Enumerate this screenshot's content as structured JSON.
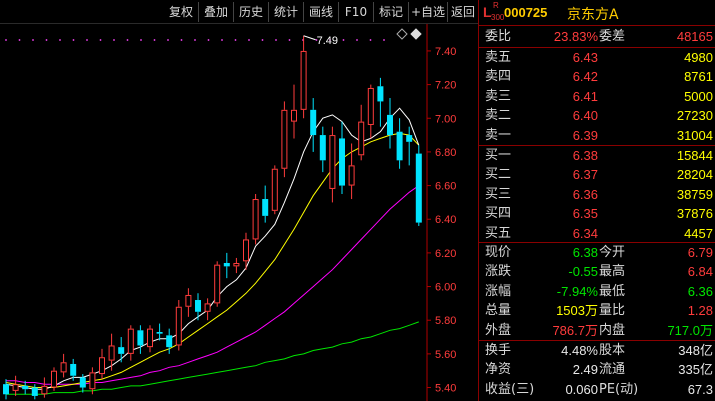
{
  "toolbar": {
    "buttons": [
      "复权",
      "叠加",
      "历史",
      "统计",
      "画线",
      "F10",
      "标记",
      "+自选",
      "返回"
    ]
  },
  "chart": {
    "high_label": "7.49",
    "y_ticks": [
      "7.40",
      "7.20",
      "7.00",
      "6.80",
      "6.60",
      "6.40",
      "6.20",
      "6.00",
      "5.80",
      "5.60",
      "5.40"
    ],
    "ylim": [
      5.32,
      7.56
    ],
    "candles": [
      {
        "o": 5.42,
        "c": 5.36,
        "h": 5.45,
        "l": 5.33
      },
      {
        "o": 5.38,
        "c": 5.42,
        "h": 5.47,
        "l": 5.35
      },
      {
        "o": 5.41,
        "c": 5.39,
        "h": 5.44,
        "l": 5.36
      },
      {
        "o": 5.4,
        "c": 5.35,
        "h": 5.42,
        "l": 5.33
      },
      {
        "o": 5.36,
        "c": 5.41,
        "h": 5.46,
        "l": 5.34
      },
      {
        "o": 5.4,
        "c": 5.5,
        "h": 5.52,
        "l": 5.38
      },
      {
        "o": 5.49,
        "c": 5.55,
        "h": 5.6,
        "l": 5.46
      },
      {
        "o": 5.54,
        "c": 5.47,
        "h": 5.57,
        "l": 5.44
      },
      {
        "o": 5.46,
        "c": 5.4,
        "h": 5.48,
        "l": 5.37
      },
      {
        "o": 5.39,
        "c": 5.49,
        "h": 5.52,
        "l": 5.36
      },
      {
        "o": 5.48,
        "c": 5.58,
        "h": 5.63,
        "l": 5.45
      },
      {
        "o": 5.56,
        "c": 5.65,
        "h": 5.72,
        "l": 5.5
      },
      {
        "o": 5.64,
        "c": 5.6,
        "h": 5.7,
        "l": 5.55
      },
      {
        "o": 5.6,
        "c": 5.75,
        "h": 5.77,
        "l": 5.56
      },
      {
        "o": 5.74,
        "c": 5.65,
        "h": 5.77,
        "l": 5.6
      },
      {
        "o": 5.64,
        "c": 5.75,
        "h": 5.77,
        "l": 5.61
      },
      {
        "o": 5.73,
        "c": 5.72,
        "h": 5.78,
        "l": 5.68
      },
      {
        "o": 5.71,
        "c": 5.64,
        "h": 5.75,
        "l": 5.6
      },
      {
        "o": 5.65,
        "c": 5.88,
        "h": 5.92,
        "l": 5.62
      },
      {
        "o": 5.88,
        "c": 5.95,
        "h": 5.99,
        "l": 5.82
      },
      {
        "o": 5.92,
        "c": 5.85,
        "h": 5.96,
        "l": 5.8
      },
      {
        "o": 5.85,
        "c": 5.9,
        "h": 5.93,
        "l": 5.8
      },
      {
        "o": 5.9,
        "c": 6.13,
        "h": 6.15,
        "l": 5.88
      },
      {
        "o": 6.14,
        "c": 6.12,
        "h": 6.2,
        "l": 6.05
      },
      {
        "o": 6.12,
        "c": 6.14,
        "h": 6.17,
        "l": 6.08
      },
      {
        "o": 6.15,
        "c": 6.28,
        "h": 6.32,
        "l": 6.1
      },
      {
        "o": 6.28,
        "c": 6.52,
        "h": 6.55,
        "l": 6.25
      },
      {
        "o": 6.52,
        "c": 6.42,
        "h": 6.6,
        "l": 6.38
      },
      {
        "o": 6.45,
        "c": 6.7,
        "h": 6.72,
        "l": 6.43
      },
      {
        "o": 6.7,
        "c": 7.05,
        "h": 7.1,
        "l": 6.65
      },
      {
        "o": 6.98,
        "c": 7.05,
        "h": 7.2,
        "l": 6.88
      },
      {
        "o": 7.05,
        "c": 7.4,
        "h": 7.49,
        "l": 7.0
      },
      {
        "o": 7.05,
        "c": 6.9,
        "h": 7.12,
        "l": 6.8
      },
      {
        "o": 6.9,
        "c": 6.75,
        "h": 6.95,
        "l": 6.68
      },
      {
        "o": 6.58,
        "c": 6.9,
        "h": 6.95,
        "l": 6.5
      },
      {
        "o": 6.88,
        "c": 6.6,
        "h": 6.98,
        "l": 6.55
      },
      {
        "o": 6.6,
        "c": 6.72,
        "h": 6.85,
        "l": 6.52
      },
      {
        "o": 6.78,
        "c": 6.98,
        "h": 7.08,
        "l": 6.75
      },
      {
        "o": 6.96,
        "c": 7.18,
        "h": 7.2,
        "l": 6.88
      },
      {
        "o": 7.19,
        "c": 7.1,
        "h": 7.24,
        "l": 6.95
      },
      {
        "o": 7.02,
        "c": 6.9,
        "h": 7.12,
        "l": 6.82
      },
      {
        "o": 6.92,
        "c": 6.75,
        "h": 7.0,
        "l": 6.7
      },
      {
        "o": 6.9,
        "c": 6.86,
        "h": 6.95,
        "l": 6.72
      },
      {
        "o": 6.79,
        "c": 6.38,
        "h": 6.84,
        "l": 6.36
      }
    ],
    "ma5": [
      5.42,
      5.41,
      5.4,
      5.39,
      5.39,
      5.41,
      5.44,
      5.46,
      5.46,
      5.48,
      5.5,
      5.53,
      5.57,
      5.62,
      5.64,
      5.67,
      5.69,
      5.69,
      5.72,
      5.78,
      5.82,
      5.86,
      5.94,
      6.0,
      6.04,
      6.11,
      6.24,
      6.3,
      6.37,
      6.5,
      6.64,
      6.8,
      6.92,
      7.0,
      7.02,
      6.98,
      6.9,
      6.86,
      6.88,
      6.92,
      7.0,
      7.06,
      6.99,
      6.84
    ],
    "ma10": [
      5.43,
      5.42,
      5.41,
      5.4,
      5.4,
      5.4,
      5.41,
      5.42,
      5.43,
      5.44,
      5.45,
      5.47,
      5.49,
      5.52,
      5.55,
      5.58,
      5.61,
      5.63,
      5.66,
      5.7,
      5.74,
      5.78,
      5.82,
      5.86,
      5.91,
      5.96,
      6.02,
      6.09,
      6.16,
      6.25,
      6.34,
      6.44,
      6.54,
      6.62,
      6.7,
      6.76,
      6.8,
      6.83,
      6.86,
      6.88,
      6.9,
      6.91,
      6.9,
      6.84
    ],
    "ma20": [
      5.44,
      5.44,
      5.43,
      5.43,
      5.42,
      5.42,
      5.42,
      5.42,
      5.42,
      5.43,
      5.43,
      5.44,
      5.45,
      5.46,
      5.47,
      5.49,
      5.5,
      5.52,
      5.53,
      5.55,
      5.57,
      5.59,
      5.61,
      5.64,
      5.67,
      5.7,
      5.73,
      5.77,
      5.81,
      5.85,
      5.9,
      5.95,
      6.0,
      6.05,
      6.1,
      6.16,
      6.22,
      6.28,
      6.34,
      6.4,
      6.46,
      6.51,
      6.56,
      6.6
    ],
    "ma60": [
      5.36,
      5.36,
      5.36,
      5.36,
      5.36,
      5.37,
      5.37,
      5.37,
      5.38,
      5.38,
      5.39,
      5.39,
      5.4,
      5.41,
      5.41,
      5.42,
      5.43,
      5.44,
      5.45,
      5.46,
      5.47,
      5.48,
      5.49,
      5.5,
      5.51,
      5.52,
      5.53,
      5.55,
      5.56,
      5.57,
      5.59,
      5.6,
      5.62,
      5.63,
      5.64,
      5.66,
      5.67,
      5.69,
      5.7,
      5.72,
      5.74,
      5.75,
      5.77,
      5.79
    ],
    "colors": {
      "up": "#ff3c3c",
      "down": "#00e4ff",
      "ma5": "#ffffff",
      "ma10": "#ffff00",
      "ma20": "#ff00ff",
      "ma60": "#00e600",
      "axis": "#b00000",
      "tick": "#ff3c3c"
    }
  },
  "stock": {
    "L": "L",
    "R": "R",
    "board": "300",
    "code": "000725",
    "name": "京东方A"
  },
  "quote": {
    "weibi_label": "委比",
    "weibi": "23.83%",
    "weicha_label": "委差",
    "weicha": "48165",
    "sells": [
      {
        "label": "卖五",
        "price": "6.43",
        "vol": "4980"
      },
      {
        "label": "卖四",
        "price": "6.42",
        "vol": "8761"
      },
      {
        "label": "卖三",
        "price": "6.41",
        "vol": "5000"
      },
      {
        "label": "卖二",
        "price": "6.40",
        "vol": "27230"
      },
      {
        "label": "卖一",
        "price": "6.39",
        "vol": "31004"
      }
    ],
    "buys": [
      {
        "label": "买一",
        "price": "6.38",
        "vol": "15844"
      },
      {
        "label": "买二",
        "price": "6.37",
        "vol": "28204"
      },
      {
        "label": "买三",
        "price": "6.36",
        "vol": "38759"
      },
      {
        "label": "买四",
        "price": "6.35",
        "vol": "37876"
      },
      {
        "label": "买五",
        "price": "6.34",
        "vol": "4457"
      }
    ],
    "stats": [
      {
        "l1": "现价",
        "v1": "6.38",
        "c1": "green",
        "l2": "今开",
        "v2": "6.79",
        "c2": "red"
      },
      {
        "l1": "涨跌",
        "v1": "-0.55",
        "c1": "green",
        "l2": "最高",
        "v2": "6.84",
        "c2": "red"
      },
      {
        "l1": "涨幅",
        "v1": "-7.94%",
        "c1": "green",
        "l2": "最低",
        "v2": "6.36",
        "c2": "green"
      },
      {
        "l1": "总量",
        "v1": "1503万",
        "c1": "yellow",
        "l2": "量比",
        "v2": "1.28",
        "c2": "red"
      },
      {
        "l1": "外盘",
        "v1": "786.7万",
        "c1": "red",
        "l2": "内盘",
        "v2": "717.0万",
        "c2": "green"
      }
    ],
    "fund": [
      {
        "l1": "换手",
        "v1": "4.48%",
        "l2": "股本",
        "v2": "348亿"
      },
      {
        "l1": "净资",
        "v1": "2.49",
        "l2": "流通",
        "v2": "335亿"
      },
      {
        "l1": "收益(三)",
        "v1": "0.060",
        "l2": "PE(动)",
        "v2": "67.3"
      }
    ]
  }
}
